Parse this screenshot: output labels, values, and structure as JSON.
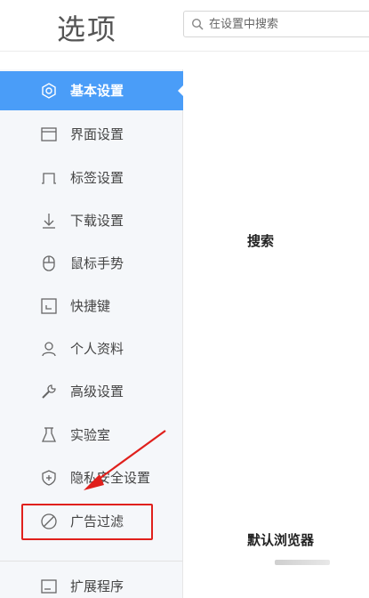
{
  "header": {
    "title": "选项",
    "search": {
      "placeholder": "在设置中搜索",
      "value": ""
    }
  },
  "sidebar": {
    "active_index": 0,
    "items": [
      {
        "label": "基本设置",
        "icon": "gear-icon"
      },
      {
        "label": "界面设置",
        "icon": "window-icon"
      },
      {
        "label": "标签设置",
        "icon": "tab-icon"
      },
      {
        "label": "下载设置",
        "icon": "download-icon"
      },
      {
        "label": "鼠标手势",
        "icon": "mouse-icon"
      },
      {
        "label": "快捷键",
        "icon": "shortcut-icon"
      },
      {
        "label": "个人资料",
        "icon": "user-icon"
      },
      {
        "label": "高级设置",
        "icon": "wrench-icon"
      },
      {
        "label": "实验室",
        "icon": "flask-icon"
      },
      {
        "label": "隐私安全设置",
        "icon": "shield-icon"
      },
      {
        "label": "广告过滤",
        "icon": "block-icon"
      },
      {
        "label": "扩展程序",
        "icon": "extension-icon"
      }
    ]
  },
  "main": {
    "sections": [
      {
        "title": "搜索"
      },
      {
        "title": "默认浏览器"
      }
    ]
  },
  "colors": {
    "accent": "#4a9df8",
    "annotation": "#e0201c"
  }
}
